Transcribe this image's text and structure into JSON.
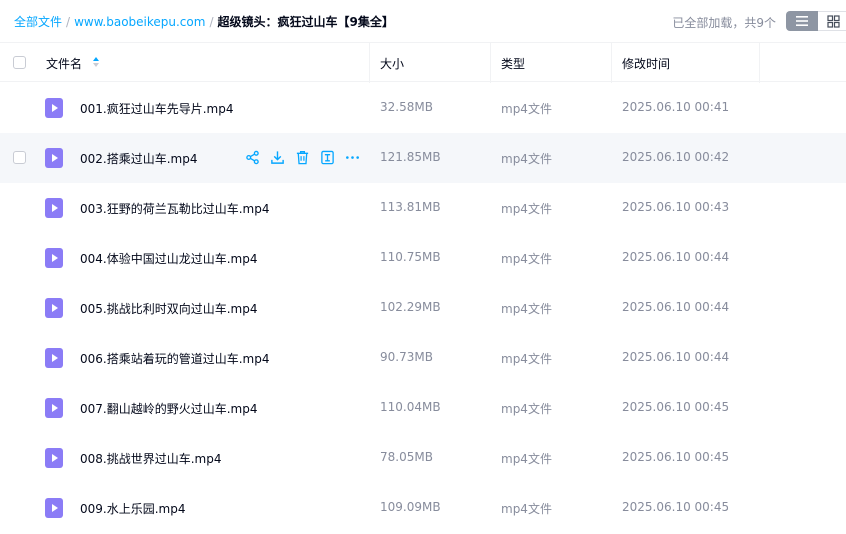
{
  "breadcrumb": {
    "root": "全部文件",
    "sep": "/",
    "site": "www.baobeikepu.com",
    "current": "超级镜头：疯狂过山车【9集全】"
  },
  "status": {
    "loaded_text": "已全部加载，共9个"
  },
  "view": {
    "list_icon": "list-view-icon",
    "grid_icon": "grid-view-icon",
    "active": "list"
  },
  "columns": {
    "name": "文件名",
    "size": "大小",
    "type": "类型",
    "modified": "修改时间"
  },
  "colors": {
    "accent": "#06a7ff",
    "file_icon": "#8b7cf6",
    "row_hover": "#f5f7fa"
  },
  "row_actions": [
    "share-icon",
    "download-icon",
    "delete-icon",
    "extract-icon",
    "more-icon"
  ],
  "files": [
    {
      "name": "001.疯狂过山车先导片.mp4",
      "size": "32.58MB",
      "type": "mp4文件",
      "modified": "2025.06.10 00:41"
    },
    {
      "name": "002.搭乘过山车.mp4",
      "size": "121.85MB",
      "type": "mp4文件",
      "modified": "2025.06.10 00:42"
    },
    {
      "name": "003.狂野的荷兰瓦勒比过山车.mp4",
      "size": "113.81MB",
      "type": "mp4文件",
      "modified": "2025.06.10 00:43"
    },
    {
      "name": "004.体验中国过山龙过山车.mp4",
      "size": "110.75MB",
      "type": "mp4文件",
      "modified": "2025.06.10 00:44"
    },
    {
      "name": "005.挑战比利时双向过山车.mp4",
      "size": "102.29MB",
      "type": "mp4文件",
      "modified": "2025.06.10 00:44"
    },
    {
      "name": "006.搭乘站着玩的管道过山车.mp4",
      "size": "90.73MB",
      "type": "mp4文件",
      "modified": "2025.06.10 00:44"
    },
    {
      "name": "007.翻山越岭的野火过山车.mp4",
      "size": "110.04MB",
      "type": "mp4文件",
      "modified": "2025.06.10 00:45"
    },
    {
      "name": "008.挑战世界过山车.mp4",
      "size": "78.05MB",
      "type": "mp4文件",
      "modified": "2025.06.10 00:45"
    },
    {
      "name": "009.水上乐园.mp4",
      "size": "109.09MB",
      "type": "mp4文件",
      "modified": "2025.06.10 00:45"
    }
  ]
}
